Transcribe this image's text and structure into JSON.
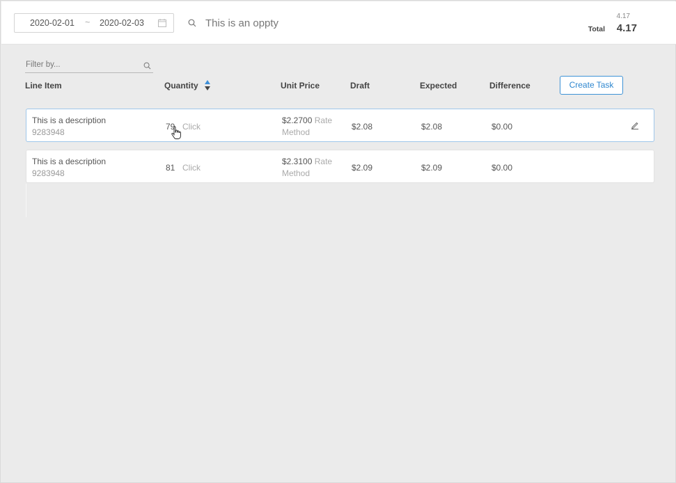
{
  "header": {
    "date_start": "2020-02-01",
    "date_separator": "~",
    "date_end": "2020-02-03",
    "search_text": "This is an oppty",
    "total_small": "4.17",
    "total_label": "Total",
    "total_value": "4.17"
  },
  "filter": {
    "placeholder": "Filter by..."
  },
  "columns": {
    "line_item": "Line Item",
    "quantity": "Quantity",
    "unit_price": "Unit Price",
    "draft": "Draft",
    "expected": "Expected",
    "difference": "Difference"
  },
  "create_task_label": "Create Task",
  "rows": [
    {
      "description": "This is a description",
      "code": "9283948",
      "quantity": "79",
      "click": "Click",
      "unit_price": "$2.2700",
      "rate": "Rate",
      "method": "Method",
      "draft": "$2.08",
      "expected": "$2.08",
      "difference": "$0.00"
    },
    {
      "description": "This is a description",
      "code": "9283948",
      "quantity": "81",
      "click": "Click",
      "unit_price": "$2.3100",
      "rate": "Rate",
      "method": "Method",
      "draft": "$2.09",
      "expected": "$2.09",
      "difference": "$0.00"
    }
  ],
  "colors": {
    "accent": "#2d86cf",
    "background": "#ebebeb",
    "active_row_border": "#9ec6ea"
  },
  "icons": [
    "calendar-icon",
    "search-icon",
    "sort-icon",
    "edit-pencil-icon",
    "hand-cursor-icon"
  ]
}
